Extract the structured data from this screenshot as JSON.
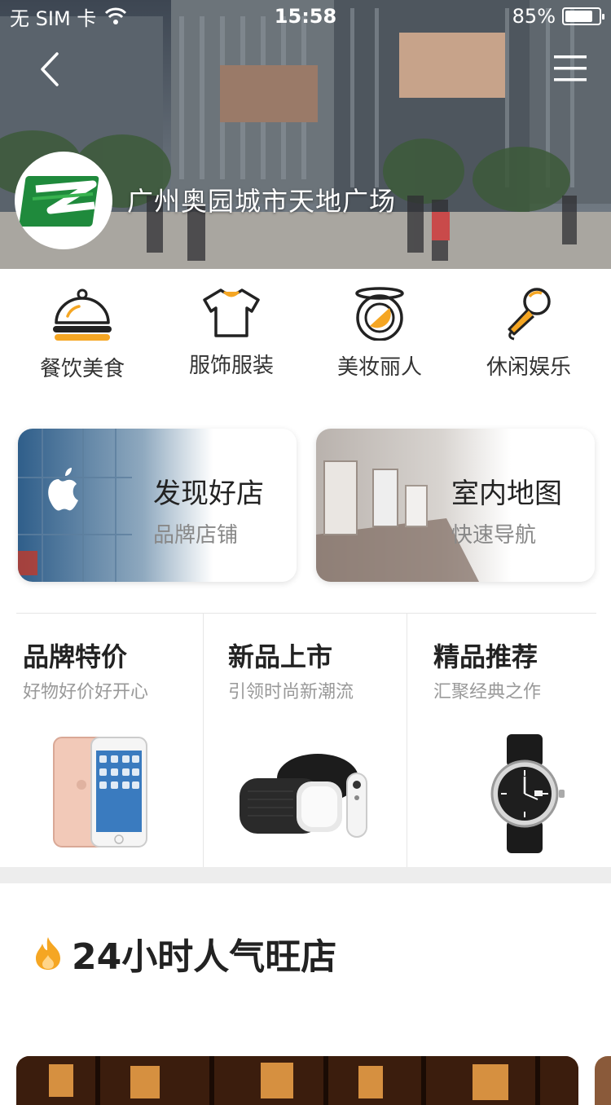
{
  "status_bar": {
    "carrier": "无 SIM 卡",
    "time": "15:58",
    "battery": "85%",
    "battery_level": 0.85
  },
  "header": {
    "mall_name": "广州奥园城市天地广场"
  },
  "categories": [
    {
      "label": "餐饮美食",
      "icon": "dining-cloche-icon"
    },
    {
      "label": "服饰服装",
      "icon": "tshirt-icon"
    },
    {
      "label": "美妆丽人",
      "icon": "compact-mirror-icon"
    },
    {
      "label": "休闲娱乐",
      "icon": "microphone-icon"
    }
  ],
  "feature_cards": [
    {
      "title": "发现好店",
      "subtitle": "品牌店铺"
    },
    {
      "title": "室内地图",
      "subtitle": "快速导航"
    }
  ],
  "promos": [
    {
      "title": "品牌特价",
      "subtitle": "好物好价好开心",
      "image": "phone"
    },
    {
      "title": "新品上市",
      "subtitle": "引领时尚新潮流",
      "image": "vr-headset"
    },
    {
      "title": "精品推荐",
      "subtitle": "汇聚经典之作",
      "image": "watch"
    }
  ],
  "hot_section": {
    "title": "24小时人气旺店",
    "icon": "flame-icon"
  },
  "colors": {
    "accent": "#F5A623",
    "text_primary": "#222222",
    "text_secondary": "#999999"
  }
}
